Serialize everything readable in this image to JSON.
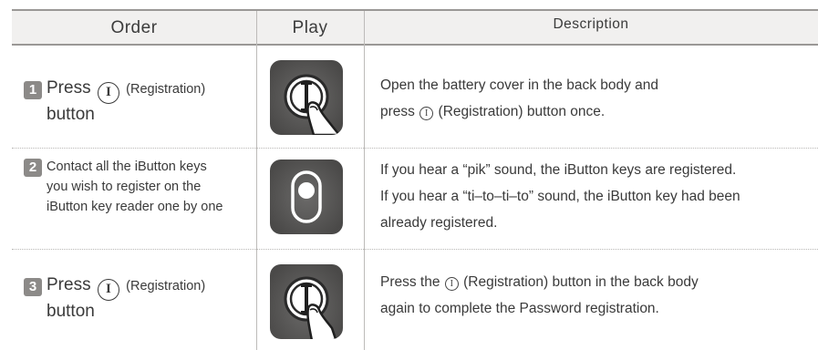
{
  "header": {
    "order": "Order",
    "play": "Play",
    "description": "Description"
  },
  "steps": [
    {
      "number": "1",
      "order_prefix": "Press",
      "order_suffix": "(Registration)",
      "order_line2": "button",
      "play_icon": "finger-pressing-registration-button-icon",
      "desc_line1": "Open the battery cover in the back body and",
      "desc_prefix": "press",
      "desc_suffix": "(Registration) button once."
    },
    {
      "number": "2",
      "order_lines": [
        "Contact all the iButton keys",
        "you wish to register on the",
        "iButton key reader one by one"
      ],
      "play_icon": "ibutton-key-reader-icon",
      "desc_lines": [
        "If you hear a “pik” sound, the iButton keys are registered.",
        "If you hear a “ti–to–ti–to” sound, the iButton key had been",
        "already registered."
      ]
    },
    {
      "number": "3",
      "order_prefix": "Press",
      "order_suffix": "(Registration)",
      "order_line2": "button",
      "play_icon": "finger-pressing-registration-button-icon",
      "desc_prefix": "Press the",
      "desc_suffix": "(Registration) button in the back body",
      "desc_line2": "again to complete the Password registration."
    }
  ],
  "registration_symbol": "I",
  "colors": {
    "header_bg": "#f1f0ef",
    "rule": "#9a9896",
    "step_badge": "#8c8a88",
    "play_dark": "#4a4948",
    "play_light": "#6b6a69"
  }
}
